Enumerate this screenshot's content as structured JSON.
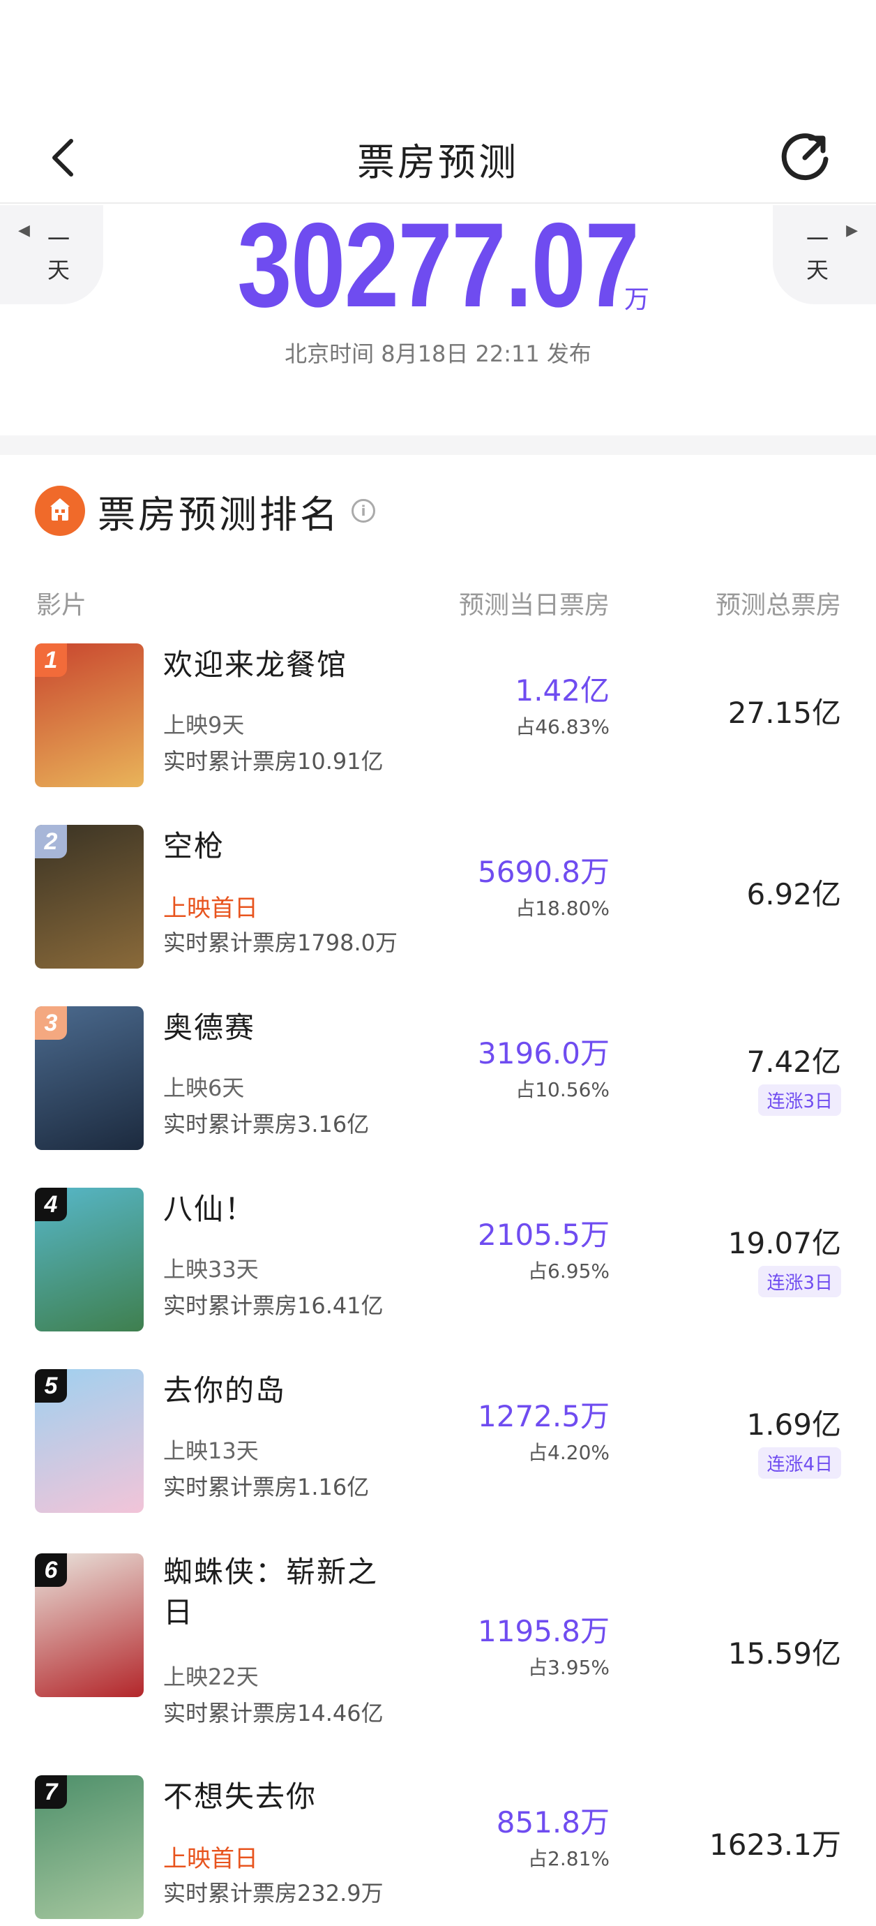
{
  "header": {
    "title": "票房预测"
  },
  "nav": {
    "prev_label": "一\n天",
    "next_label": "一\n天"
  },
  "summary": {
    "total": "30277.07",
    "unit": "万",
    "publish_info": "北京时间 8月18日 22:11 发布"
  },
  "ranking": {
    "title": "票房预测排名",
    "columns": {
      "film": "影片",
      "today": "预测当日票房",
      "total": "预测总票房"
    },
    "rows": [
      {
        "rank": "1",
        "name": "欢迎来龙餐馆",
        "days": "上映9天",
        "first_day": false,
        "cumulative": "实时累计票房10.91亿",
        "today": "1.42亿",
        "share": "占46.83%",
        "total": "27.15亿",
        "streak": "",
        "badge_color": "#f26b3a",
        "poster_colors": [
          "#c8452e",
          "#e9b45a"
        ]
      },
      {
        "rank": "2",
        "name": "空枪",
        "days": "上映首日",
        "first_day": true,
        "cumulative": "实时累计票房1798.0万",
        "today": "5690.8万",
        "share": "占18.80%",
        "total": "6.92亿",
        "streak": "",
        "badge_color": "#a7b6d8",
        "poster_colors": [
          "#3a3324",
          "#8a6a3a"
        ]
      },
      {
        "rank": "3",
        "name": "奥德赛",
        "days": "上映6天",
        "first_day": false,
        "cumulative": "实时累计票房3.16亿",
        "today": "3196.0万",
        "share": "占10.56%",
        "total": "7.42亿",
        "streak": "连涨3日",
        "badge_color": "#f4a880",
        "poster_colors": [
          "#4b6a8e",
          "#1c2a3e"
        ]
      },
      {
        "rank": "4",
        "name": "八仙！",
        "days": "上映33天",
        "first_day": false,
        "cumulative": "实时累计票房16.41亿",
        "today": "2105.5万",
        "share": "占6.95%",
        "total": "19.07亿",
        "streak": "连涨3日",
        "badge_color": "#111111",
        "poster_colors": [
          "#57b7c9",
          "#3f7f4e"
        ]
      },
      {
        "rank": "5",
        "name": "去你的岛",
        "days": "上映13天",
        "first_day": false,
        "cumulative": "实时累计票房1.16亿",
        "today": "1272.5万",
        "share": "占4.20%",
        "total": "1.69亿",
        "streak": "连涨4日",
        "badge_color": "#111111",
        "poster_colors": [
          "#9fd0ef",
          "#f2c4d8"
        ]
      },
      {
        "rank": "6",
        "name": "蜘蛛侠：崭新之日",
        "days": "上映22天",
        "first_day": false,
        "cumulative": "实时累计票房14.46亿",
        "today": "1195.8万",
        "share": "占3.95%",
        "total": "15.59亿",
        "streak": "",
        "badge_color": "#111111",
        "poster_colors": [
          "#e9e4dd",
          "#b3262a"
        ]
      },
      {
        "rank": "7",
        "name": "不想失去你",
        "days": "上映首日",
        "first_day": true,
        "cumulative": "实时累计票房232.9万",
        "today": "851.8万",
        "share": "占2.81%",
        "total": "1623.1万",
        "streak": "",
        "badge_color": "#111111",
        "poster_colors": [
          "#4d8f6a",
          "#a8c8a0"
        ]
      }
    ]
  }
}
